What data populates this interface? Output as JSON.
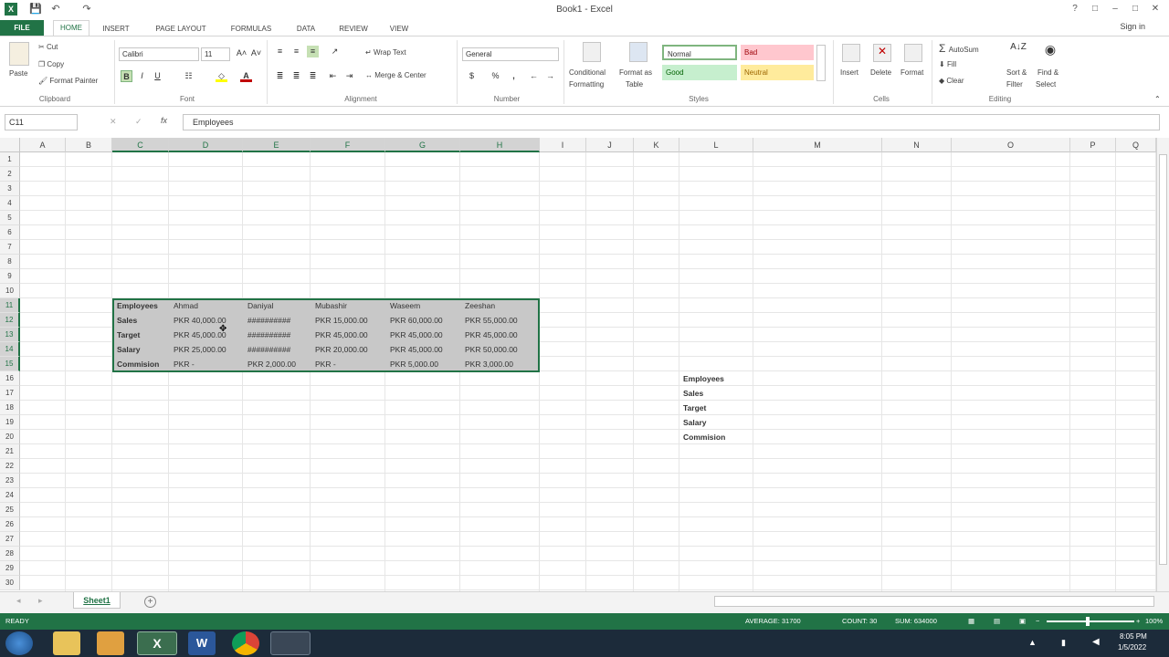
{
  "window": {
    "title": "Book1 - Excel",
    "sign_in": "Sign in"
  },
  "qat": {
    "save_icon": "save-icon",
    "undo_icon": "undo-icon",
    "redo_icon": "redo-icon"
  },
  "tabs": {
    "file": "FILE",
    "home": "HOME",
    "insert": "INSERT",
    "page_layout": "PAGE LAYOUT",
    "formulas": "FORMULAS",
    "data": "DATA",
    "review": "REVIEW",
    "view": "VIEW"
  },
  "ribbon": {
    "clipboard": {
      "paste": "Paste",
      "cut": "Cut",
      "copy": "Copy",
      "format_painter": "Format Painter",
      "label": "Clipboard"
    },
    "font": {
      "name": "Calibri",
      "size": "11",
      "bold": "B",
      "italic": "I",
      "underline": "U",
      "label": "Font"
    },
    "alignment": {
      "wrap_text": "Wrap Text",
      "merge_center": "Merge & Center",
      "label": "Alignment"
    },
    "number": {
      "format": "General",
      "currency": "$",
      "percent": "%",
      "comma": ",",
      "label": "Number"
    },
    "styles": {
      "conditional": "Conditional",
      "formatting": "Formatting",
      "format_as": "Format as",
      "table": "Table",
      "normal": "Normal",
      "bad": "Bad",
      "good": "Good",
      "neutral": "Neutral",
      "label": "Styles",
      "colors": {
        "bad_bg": "#ffc7ce",
        "good_bg": "#c6efce",
        "neutral_bg": "#ffeb9c"
      }
    },
    "cells": {
      "insert": "Insert",
      "delete": "Delete",
      "format": "Format",
      "label": "Cells"
    },
    "editing": {
      "autosum": "AutoSum",
      "fill": "Fill",
      "clear": "Clear",
      "sort_filter": "Sort &",
      "filter": "Filter",
      "find_select": "Find &",
      "select": "Select",
      "label": "Editing"
    }
  },
  "formula_bar": {
    "name_box": "C11",
    "value": "Employees"
  },
  "columns": [
    "A",
    "B",
    "C",
    "D",
    "E",
    "F",
    "G",
    "H",
    "I",
    "J",
    "K",
    "L",
    "M",
    "N",
    "O",
    "P",
    "Q"
  ],
  "rows": [
    "1",
    "2",
    "3",
    "4",
    "5",
    "6",
    "7",
    "8",
    "9",
    "10",
    "11",
    "12",
    "13",
    "14",
    "15",
    "16",
    "17",
    "18",
    "19",
    "20",
    "21",
    "22",
    "23",
    "24",
    "25",
    "26",
    "27",
    "28",
    "29",
    "30"
  ],
  "table": {
    "rows": [
      [
        "Employees",
        "Ahmad",
        "Daniyal",
        "Mubashir",
        "Waseem",
        "Zeeshan"
      ],
      [
        "Sales",
        "PKR  40,000.00",
        "##########",
        "PKR  15,000.00",
        "PKR  60,000.00",
        "PKR    55,000.00"
      ],
      [
        "Target",
        "PKR  45,000.00",
        "##########",
        "PKR  45,000.00",
        "PKR  45,000.00",
        "PKR    45,000.00"
      ],
      [
        "Salary",
        "PKR  25,000.00",
        "##########",
        "PKR  20,000.00",
        "PKR  45,000.00",
        "PKR    50,000.00"
      ],
      [
        "Commision",
        "PKR          -",
        "PKR 2,000.00",
        "PKR          -",
        "PKR    5,000.00",
        "PKR      3,000.00"
      ]
    ]
  },
  "list_l": [
    "Employees",
    "Sales",
    "Target",
    "Salary",
    "Commision"
  ],
  "sheet": {
    "tab": "Sheet1",
    "add_icon": "plus-circle-icon"
  },
  "status": {
    "ready": "READY",
    "average": "AVERAGE: 31700",
    "count": "COUNT: 30",
    "sum": "SUM: 634000",
    "zoom": "100%"
  },
  "taskbar": {
    "time": "8:05 PM",
    "date": "1/5/2022"
  },
  "accent": "#217346"
}
